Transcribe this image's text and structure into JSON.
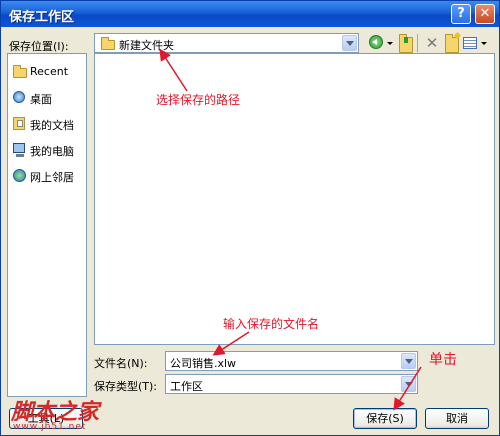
{
  "window": {
    "title": "保存工作区"
  },
  "titlebar": {
    "help_label": "?",
    "close_label": "✕"
  },
  "location": {
    "label": "保存位置(I):",
    "value": "新建文件夹"
  },
  "toolbar": {
    "delete_label": "✕"
  },
  "places": [
    {
      "label": "Recent",
      "icon": "folder-icon"
    },
    {
      "label": "桌面",
      "icon": "desktop-icon"
    },
    {
      "label": "我的文档",
      "icon": "my-documents-icon"
    },
    {
      "label": "我的电脑",
      "icon": "my-computer-icon"
    },
    {
      "label": "网上邻居",
      "icon": "network-icon"
    }
  ],
  "filename": {
    "label": "文件名(N):",
    "value": "公司销售.xlw"
  },
  "filetype": {
    "label": "保存类型(T):",
    "value": "工作区"
  },
  "buttons": {
    "tools": "工具(L)",
    "save": "保存(S)",
    "cancel": "取消"
  },
  "annotations": {
    "path_hint": "选择保存的路径",
    "name_hint": "输入保存的文件名",
    "click_hint": "单击"
  },
  "watermark": {
    "text": "脚本之家",
    "url": "www.jb51.net"
  },
  "colors": {
    "annotation": "#e0182a",
    "titlebar": "#0a49c6"
  }
}
